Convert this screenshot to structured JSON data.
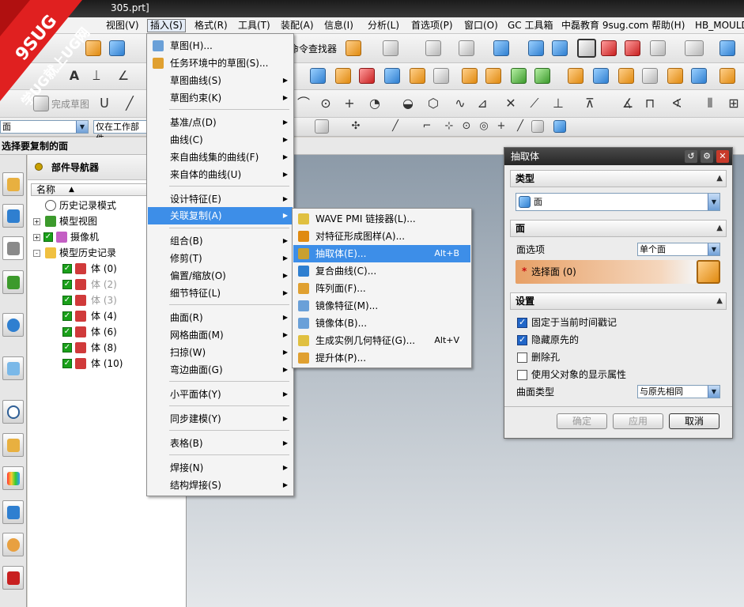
{
  "window": {
    "title_fragment": "305.prt]"
  },
  "logo": {
    "brand": "9SUG",
    "slogan": "学UG就上UG网",
    "main_color": "#e02020"
  },
  "menubar": {
    "items": [
      {
        "label": "视图(V)"
      },
      {
        "label": "插入(S)"
      },
      {
        "label": "格式(R)"
      },
      {
        "label": "工具(T)"
      },
      {
        "label": "装配(A)"
      },
      {
        "label": "信息(I)"
      },
      {
        "label": "分析(L)"
      },
      {
        "label": "首选项(P)"
      },
      {
        "label": "窗口(O)"
      },
      {
        "label": "GC 工具箱"
      },
      {
        "label": "中磊教育 9sug.com"
      },
      {
        "label": "帮助(H)"
      },
      {
        "label": "HB_MOULD MO"
      }
    ],
    "active": "插入(S)"
  },
  "toolbar": {
    "command_finder": "命令查找器",
    "finish_sketch": "完成草图"
  },
  "selection_bar": {
    "filter_value": "面",
    "scope_value": "仅在工作部件"
  },
  "cue_line": "选择要复制的面",
  "part_navigator": {
    "title": "部件导航器",
    "column_name": "名称",
    "rows": [
      {
        "label": "历史记录模式",
        "level": 0,
        "expander": ""
      },
      {
        "label": "模型视图",
        "level": 0,
        "expander": "+"
      },
      {
        "label": "摄像机",
        "level": 0,
        "expander": "+"
      },
      {
        "label": "模型历史记录",
        "level": 0,
        "expander": "-"
      },
      {
        "label": "体 (0)",
        "level": 1,
        "dim": false
      },
      {
        "label": "体 (2)",
        "level": 1,
        "dim": true
      },
      {
        "label": "体 (3)",
        "level": 1,
        "dim": true
      },
      {
        "label": "体 (4)",
        "level": 1,
        "dim": false
      },
      {
        "label": "体 (6)",
        "level": 1,
        "dim": false
      },
      {
        "label": "体 (8)",
        "level": 1,
        "dim": false
      },
      {
        "label": "体 (10)",
        "level": 1,
        "dim": false
      }
    ]
  },
  "insert_menu": {
    "items": [
      {
        "label": "草图(H)...",
        "sub": false
      },
      {
        "label": "任务环境中的草图(S)...",
        "sub": false
      },
      {
        "label": "草图曲线(S)",
        "sub": true
      },
      {
        "label": "草图约束(K)",
        "sub": true
      },
      {
        "label": "基准/点(D)",
        "sub": true
      },
      {
        "label": "曲线(C)",
        "sub": true
      },
      {
        "label": "来自曲线集的曲线(F)",
        "sub": true
      },
      {
        "label": "来自体的曲线(U)",
        "sub": true
      },
      {
        "label": "设计特征(E)",
        "sub": true
      },
      {
        "label": "关联复制(A)",
        "sub": true
      },
      {
        "label": "组合(B)",
        "sub": true
      },
      {
        "label": "修剪(T)",
        "sub": true
      },
      {
        "label": "偏置/缩放(O)",
        "sub": true
      },
      {
        "label": "细节特征(L)",
        "sub": true
      },
      {
        "label": "曲面(R)",
        "sub": true
      },
      {
        "label": "网格曲面(M)",
        "sub": true
      },
      {
        "label": "扫掠(W)",
        "sub": true
      },
      {
        "label": "弯边曲面(G)",
        "sub": true
      },
      {
        "label": "小平面体(Y)",
        "sub": true
      },
      {
        "label": "同步建模(Y)",
        "sub": true
      },
      {
        "label": "表格(B)",
        "sub": true
      },
      {
        "label": "焊接(N)",
        "sub": true
      },
      {
        "label": "结构焊接(S)",
        "sub": true
      }
    ],
    "highlighted": "关联复制(A)"
  },
  "assoc_copy_menu": {
    "items": [
      {
        "label": "WAVE PMI 链接器(L)...",
        "accel": ""
      },
      {
        "label": "对特征形成图样(A)...",
        "accel": ""
      },
      {
        "label": "抽取体(E)...",
        "accel": "Alt+B"
      },
      {
        "label": "复合曲线(C)...",
        "accel": ""
      },
      {
        "label": "阵列面(F)...",
        "accel": ""
      },
      {
        "label": "镜像特征(M)...",
        "accel": ""
      },
      {
        "label": "镜像体(B)...",
        "accel": ""
      },
      {
        "label": "生成实例几何特征(G)...",
        "accel": "Alt+V"
      },
      {
        "label": "提升体(P)...",
        "accel": ""
      }
    ],
    "highlighted": "抽取体(E)..."
  },
  "dialog": {
    "title": "抽取体",
    "type_group": "类型",
    "type_value": "面",
    "face_group": "面",
    "face_option_label": "面选项",
    "face_option_value": "单个面",
    "select_face": "选择面 (0)",
    "required_mark": "*",
    "settings_group": "设置",
    "checkboxes": [
      {
        "label": "固定于当前时间戳记",
        "checked": true
      },
      {
        "label": "隐藏原先的",
        "checked": true
      },
      {
        "label": "删除孔",
        "checked": false
      },
      {
        "label": "使用父对象的显示属性",
        "checked": false
      }
    ],
    "surface_type_label": "曲面类型",
    "surface_type_value": "与原先相同",
    "buttons": {
      "ok": "确定",
      "apply": "应用",
      "cancel": "取消"
    }
  },
  "colors": {
    "menu_highlight": "#3d8ee8",
    "dialog_selection_bg": "#e7a066",
    "toolbar_bg": "#ececec"
  }
}
